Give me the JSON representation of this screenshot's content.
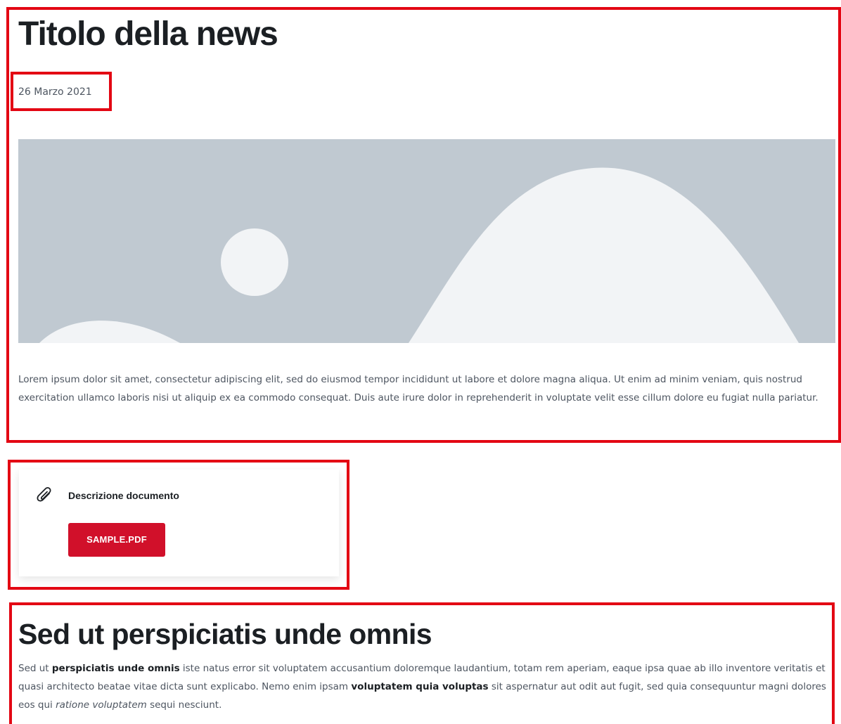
{
  "news": {
    "title": "Titolo della news",
    "date": "26 Marzo 2021",
    "hero_image": {
      "icon": "image-placeholder",
      "background": "#c0c9d1",
      "shape_color": "#f2f4f6"
    },
    "lead": "Lorem ipsum dolor sit amet, consectetur adipiscing elit, sed do eiusmod tempor incididunt ut labore et dolore magna aliqua. Ut enim ad minim veniam, quis nostrud exercitation ullamco laboris nisi ut aliquip ex ea commodo consequat. Duis aute irure dolor in reprehenderit in voluptate velit esse cillum dolore eu fugiat nulla pariatur."
  },
  "attachment": {
    "icon": "paperclip-icon",
    "description": "Descrizione documento",
    "button_label": "SAMPLE.PDF",
    "button_color": "#d1102a"
  },
  "section": {
    "title": "Sed ut perspiciatis unde omnis",
    "body": {
      "p1": "Sed ut ",
      "b1": "perspiciatis unde omnis",
      "p2": " iste natus error sit voluptatem accusantium doloremque laudantium, totam rem aperiam, eaque ipsa quae ab illo inventore veritatis et quasi architecto beatae vitae dicta sunt explicabo. Nemo enim ipsam ",
      "b2": "voluptatem quia voluptas",
      "p3": " sit aspernatur aut odit aut fugit, sed quia consequuntur magni dolores eos qui ",
      "i1": "ratione voluptatem",
      "p4": " sequi nesciunt."
    }
  },
  "annotation_color": "#e30613"
}
